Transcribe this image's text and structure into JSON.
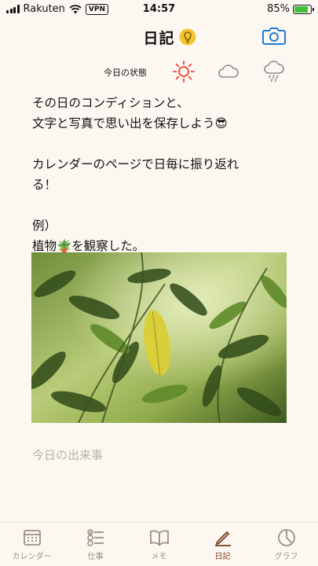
{
  "status_bar": {
    "carrier": "Rakuten",
    "vpn": "VPN",
    "time": "14:57",
    "battery": "85%",
    "battery_level": 0.85
  },
  "header": {
    "title": "日記",
    "bulb_icon": "lightbulb-icon",
    "camera_icon": "camera-icon"
  },
  "weather": {
    "label": "今日の状態",
    "options": [
      "sun-icon",
      "cloud-icon",
      "rain-icon"
    ]
  },
  "note": {
    "line1": "その日のコンディションと、",
    "line2": "文字と写真で思い出を保存しよう😎",
    "line3": "カレンダーのページで日毎に振り返れ",
    "line4": "る！",
    "line5": "例）",
    "line6": "植物🪴を観察した。",
    "input_placeholder": "今日の出来事"
  },
  "tabs": [
    {
      "label": "カレンダー",
      "icon": "calendar-icon"
    },
    {
      "label": "仕事",
      "icon": "checklist-icon"
    },
    {
      "label": "メモ",
      "icon": "book-icon"
    },
    {
      "label": "日記",
      "icon": "pen-icon",
      "active": true
    },
    {
      "label": "グラフ",
      "icon": "pie-chart-icon"
    }
  ],
  "colors": {
    "background": "#fcf8f1",
    "accent_blue": "#1f7bd6",
    "sun_red": "#e8413b",
    "bulb_yellow": "#f4c430",
    "active_tab": "#7a3a1c",
    "inactive_tab": "#9b8f80"
  }
}
